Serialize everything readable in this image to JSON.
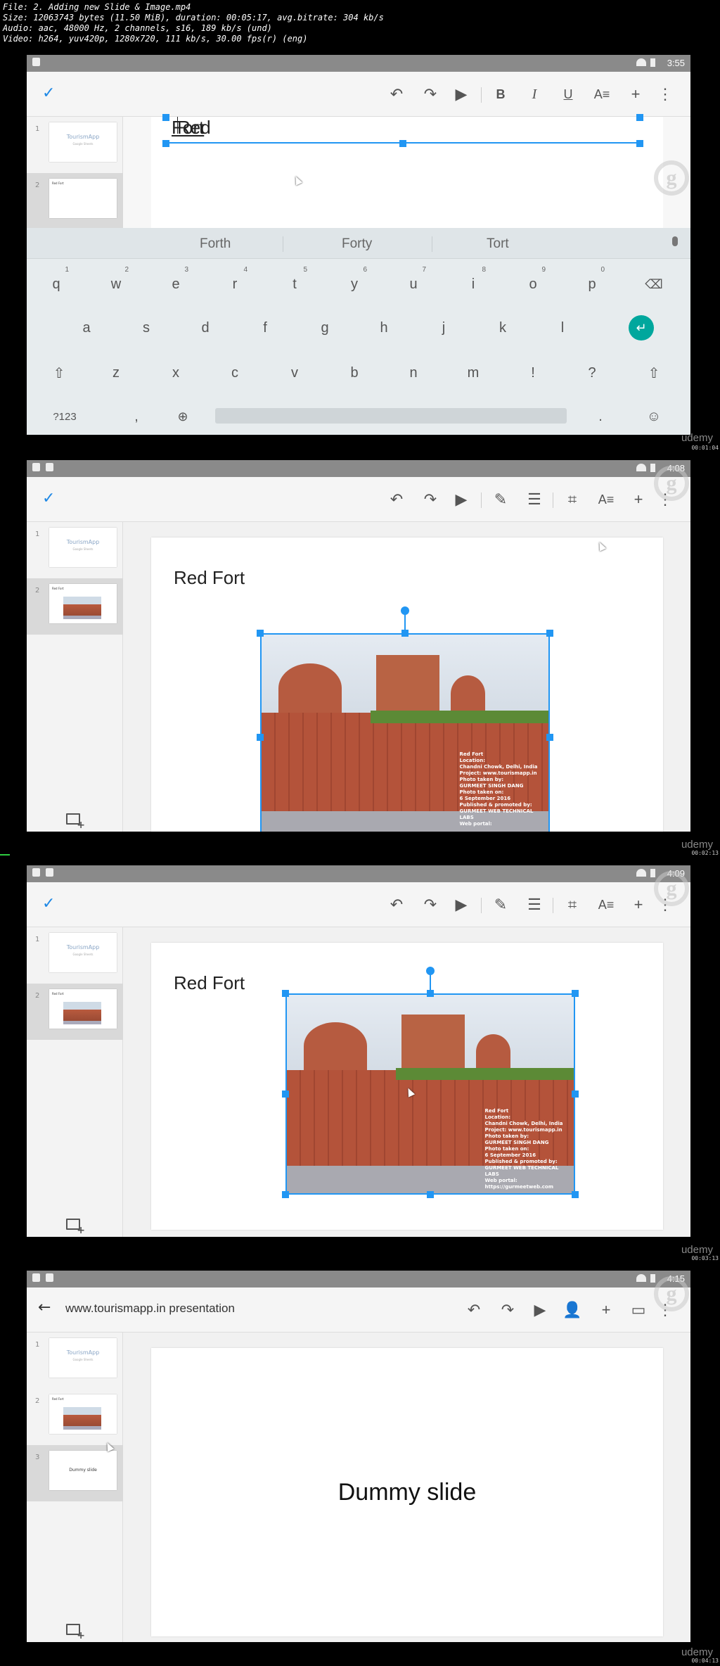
{
  "file_info": {
    "line1": "File: 2. Adding new Slide & Image.mp4",
    "line2": "Size: 12063743 bytes (11.50 MiB), duration: 00:05:17, avg.bitrate: 304 kb/s",
    "line3": "Audio: aac, 48000 Hz, 2 channels, s16, 189 kb/s (und)",
    "line4": "Video: h264, yuv420p, 1280x720, 111 kb/s, 30.00 fps(r) (eng)"
  },
  "frames": [
    {
      "clock": "3:55",
      "timestamp": "00:01:04",
      "title_text_a": "Red ",
      "title_text_b": "Fort",
      "suggestions": [
        "Forth",
        "Forty",
        "Tort"
      ],
      "keys_row1": [
        "q",
        "w",
        "e",
        "r",
        "t",
        "y",
        "u",
        "i",
        "o",
        "p"
      ],
      "keys_row1_nums": [
        "1",
        "2",
        "3",
        "4",
        "5",
        "6",
        "7",
        "8",
        "9",
        "0"
      ],
      "keys_row2": [
        "a",
        "s",
        "d",
        "f",
        "g",
        "h",
        "j",
        "k",
        "l"
      ],
      "keys_row3": [
        "z",
        "x",
        "c",
        "v",
        "b",
        "n",
        "m",
        "!",
        "?"
      ],
      "key_123": "?123",
      "key_comma": ",",
      "key_period": ".",
      "thumb1_title": "TourismApp",
      "thumb1_sub": "Google Sheets",
      "thumb2_label": "Red Fort"
    },
    {
      "clock": "4:08",
      "timestamp": "00:02:13",
      "slide_title": "Red Fort"
    },
    {
      "clock": "4:09",
      "timestamp": "00:03:13",
      "slide_title": "Red Fort"
    },
    {
      "clock": "4:15",
      "timestamp": "00:04:13",
      "doc_title": "www.tourismapp.in presentation",
      "slide_text": "Dummy slide",
      "thumb3_label": "Dummy slide"
    }
  ],
  "photo_caption": [
    "Red Fort",
    "Location:",
    "Chandni Chowk, Delhi, India",
    "Project: www.tourismapp.in",
    "Photo taken by:",
    "GURMEET SINGH DANG",
    "Photo taken on:",
    "6 September 2016",
    "Published & promoted by:",
    "GURMEET WEB TECHNICAL LABS",
    "Web portal:",
    "https://gurmeetweb.com"
  ],
  "watermark": "udemy",
  "logo_letter": "g",
  "icons": {
    "check": "check-icon",
    "undo": "undo-icon",
    "redo": "redo-icon",
    "play": "play-icon",
    "bold": "B",
    "italic": "I",
    "underline": "U",
    "text_format": "text-format-icon",
    "add": "plus-icon",
    "more": "more-vert-icon",
    "pencil": "pencil-icon",
    "align": "align-icon",
    "crop": "crop-icon",
    "add_person": "add-person-icon",
    "comment": "comment-icon",
    "back": "arrow-back-icon"
  }
}
